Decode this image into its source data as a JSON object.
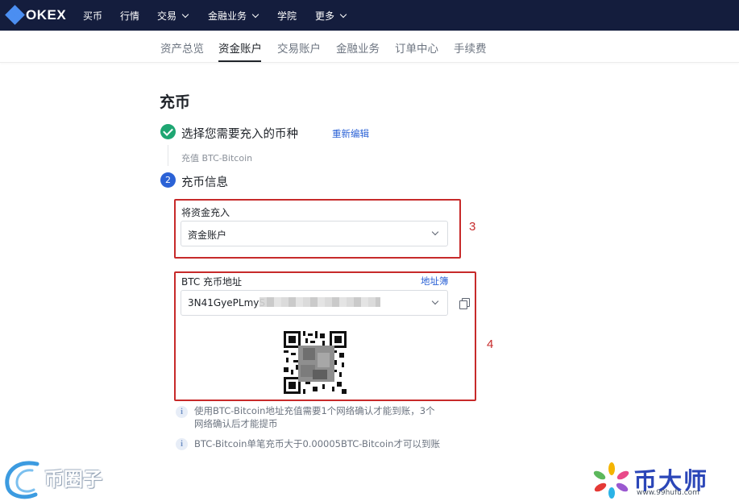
{
  "topbar": {
    "logo_text": "OKEX",
    "nav": [
      {
        "label": "买币"
      },
      {
        "label": "行情"
      },
      {
        "label": "交易"
      },
      {
        "label": "金融业务"
      },
      {
        "label": "学院"
      },
      {
        "label": "更多"
      }
    ],
    "colors": {
      "background": "#141d3d",
      "logo": "#4b8ef1"
    }
  },
  "subnav": {
    "tabs": [
      {
        "label": "资产总览"
      },
      {
        "label": "资金账户",
        "active": true
      },
      {
        "label": "交易账户"
      },
      {
        "label": "金融业务"
      },
      {
        "label": "订单中心"
      },
      {
        "label": "手续费"
      }
    ]
  },
  "page": {
    "title": "充币",
    "step1": {
      "label": "选择您需要充入的币种",
      "edit_link": "重新编辑",
      "detail": "充值 BTC-Bitcoin",
      "status_icon": "check-icon"
    },
    "step2": {
      "number": "2",
      "label": "充币信息"
    },
    "fund_target": {
      "label": "将资金充入",
      "value": "资金账户"
    },
    "address": {
      "label": "BTC 充币地址",
      "address_book": "地址簿",
      "value_visible": "3N41GyePLmyS"
    },
    "annotations": [
      "3",
      "4"
    ],
    "notes": [
      "使用BTC-Bitcoin地址充值需要1个网络确认才能到账，3个网络确认后才能提币",
      "BTC-Bitcoin单笔充币大于0.00005BTC-Bitcoin才可以到账"
    ],
    "colors": {
      "accent": "#2b62d6",
      "success": "#1ea672",
      "annotation": "#c72a2a"
    }
  },
  "watermarks": {
    "left": "币圈子",
    "right": "币大师",
    "right_url": "www.99hufu.com"
  }
}
